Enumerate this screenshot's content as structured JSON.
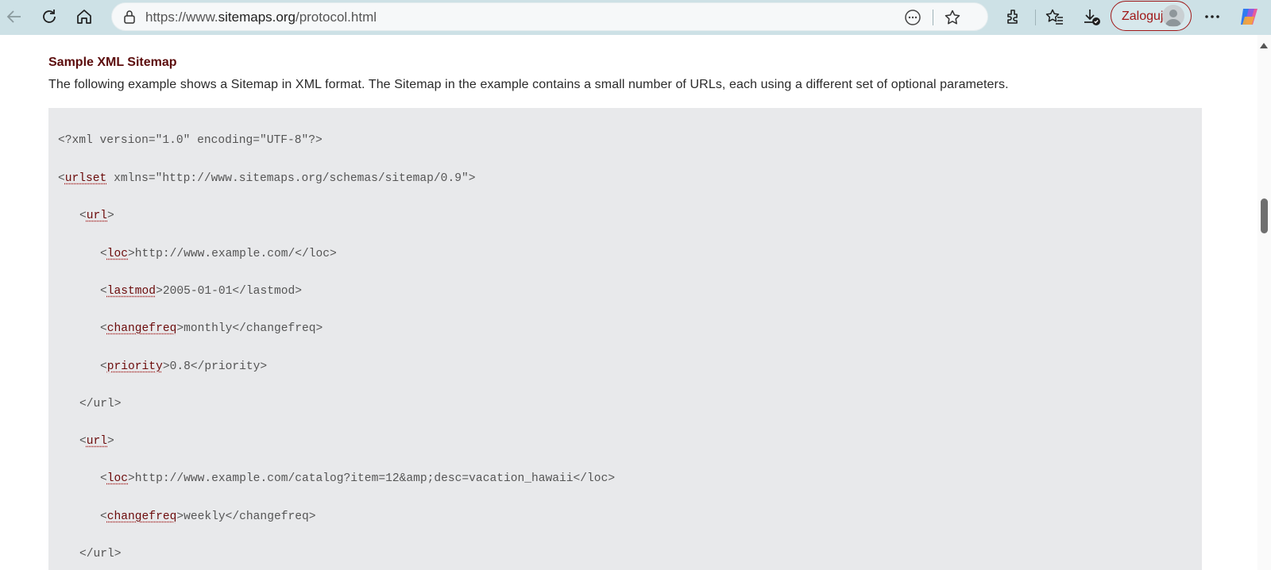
{
  "browser": {
    "url_prefix": "https://www.",
    "url_domain": "sitemaps.org",
    "url_path": "/protocol.html",
    "login_label": "Zaloguj",
    "icons": [
      "back-icon",
      "reload-icon",
      "home-icon",
      "lock-icon",
      "read-aloud-icon",
      "favorite-star-icon",
      "extensions-icon",
      "favorites-icon",
      "downloads-icon",
      "profile-icon",
      "more-icon",
      "copilot-icon"
    ]
  },
  "content": {
    "section_title": "Sample XML Sitemap",
    "intro": "The following example shows a Sitemap in XML format. The Sitemap in the example contains a small number of URLs, each using a different set of optional parameters."
  },
  "code_lines": [
    {
      "pre": "<?xml version=\"1.0\" encoding=\"UTF-8\"?>",
      "tag": "",
      "post": ""
    },
    {
      "pre": "<",
      "tag": "urlset",
      "post": " xmlns=\"http://www.sitemaps.org/schemas/sitemap/0.9\">"
    },
    {
      "pre": "<",
      "tag": "url",
      "post": ">"
    },
    {
      "pre": "<",
      "tag": "loc",
      "post": ">http://www.example.com/</loc>"
    },
    {
      "pre": "<",
      "tag": "lastmod",
      "post": ">2005-01-01</lastmod>"
    },
    {
      "pre": "<",
      "tag": "changefreq",
      "post": ">monthly</changefreq>"
    },
    {
      "pre": "<",
      "tag": "priority",
      "post": ">0.8</priority>"
    },
    {
      "pre": "</url>",
      "tag": "",
      "post": ""
    },
    {
      "pre": "<",
      "tag": "url",
      "post": ">"
    },
    {
      "pre": "<",
      "tag": "loc",
      "post": ">http://www.example.com/catalog?item=12&amp;desc=vacation_hawaii</loc>"
    },
    {
      "pre": "<",
      "tag": "changefreq",
      "post": ">weekly</changefreq>"
    },
    {
      "pre": "</url>",
      "tag": "",
      "post": ""
    }
  ],
  "colors": {
    "toolbar": "#cde1e6",
    "heading": "#5c0d0d",
    "tag": "#6b0a0a",
    "code_bg": "#e8e9eb",
    "login_border": "#a01818"
  }
}
